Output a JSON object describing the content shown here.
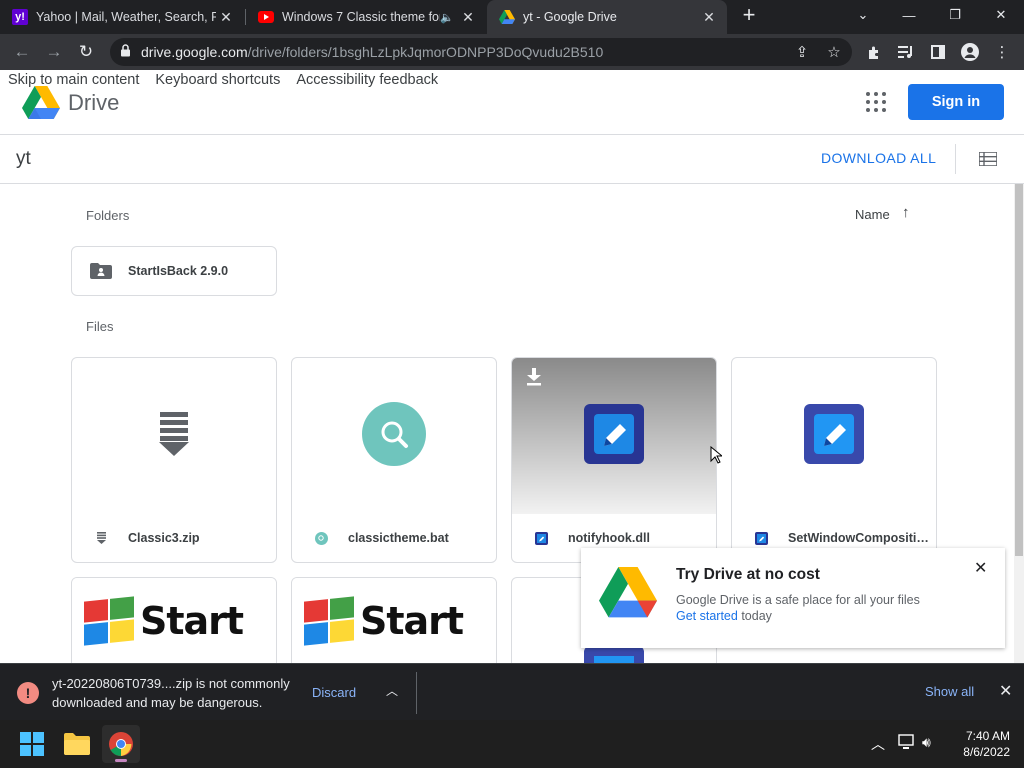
{
  "browser": {
    "tabs": [
      {
        "title": "Yahoo | Mail, Weather, Search, Po",
        "favicon": "yahoo-icon",
        "active": false
      },
      {
        "title": "Windows 7 Classic theme for",
        "favicon": "youtube-icon",
        "active": false,
        "audio": true
      },
      {
        "title": "yt - Google Drive",
        "favicon": "google-drive-icon",
        "active": true
      }
    ],
    "new_tab": "+",
    "window_controls": {
      "tab_search": "⌄",
      "minimize": "—",
      "restore": "❐",
      "close": "✕"
    },
    "url_host": "drive.google.com",
    "url_path": "/drive/folders/1bsghLzLpkJqmorODNPP3DoQvudu2B510"
  },
  "page": {
    "skip_links": [
      "Skip to main content",
      "Keyboard shortcuts",
      "Accessibility feedback"
    ],
    "brand": "Drive",
    "sign_in": "Sign in",
    "folder_name": "yt",
    "download_all": "DOWNLOAD ALL",
    "folders_label": "Folders",
    "sort_label": "Name",
    "sort_arrow": "↑",
    "folders": [
      {
        "name": "StartIsBack 2.9.0"
      }
    ],
    "files_label": "Files",
    "files": [
      {
        "name": "Classic3.zip",
        "icon": "zip-icon"
      },
      {
        "name": "classictheme.bat",
        "icon": "script-icon"
      },
      {
        "name": "notifyhook.dll",
        "icon": "dll-icon"
      },
      {
        "name": "SetWindowCompositi…",
        "icon": "dll-icon"
      }
    ],
    "start_image_text": "Start",
    "promo": {
      "title": "Try Drive at no cost",
      "description": "Google Drive is a safe place for all your files",
      "link": "Get started",
      "link_suffix": " today"
    }
  },
  "download_bar": {
    "message_line1": "yt-20220806T0739....zip is not commonly",
    "message_line2": "downloaded and may be dangerous.",
    "discard": "Discard",
    "show_all": "Show all"
  },
  "taskbar": {
    "time": "7:40 AM",
    "date": "8/6/2022"
  },
  "colors": {
    "accent": "#1a73e8",
    "chrome_dark": "#202124",
    "warning": "#f28b82"
  }
}
